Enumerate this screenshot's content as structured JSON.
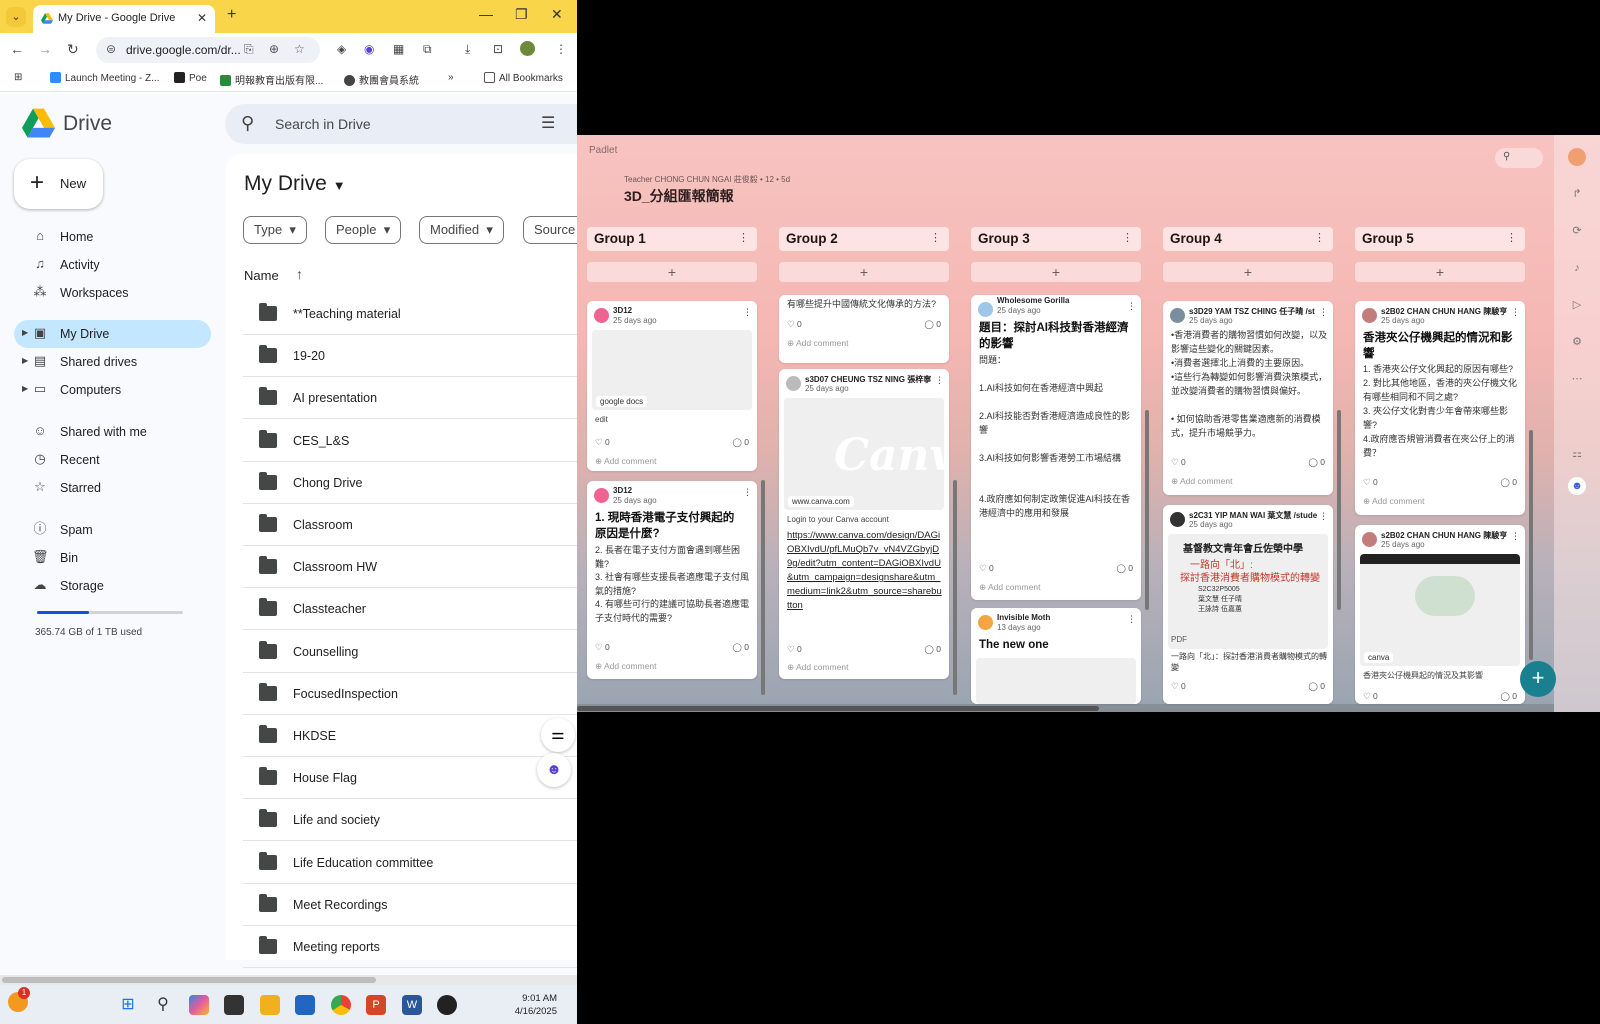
{
  "browser": {
    "tab_title": "My Drive - Google Drive",
    "url": "drive.google.com/dr...",
    "bookmarks": [
      "Launch Meeting - Z...",
      "Poe",
      "明報教育出版有限...",
      "教團會員系統",
      "All Bookmarks"
    ],
    "more_label": "»"
  },
  "drive": {
    "app_name": "Drive",
    "search_placeholder": "Search in Drive",
    "new_label": "New",
    "nav": [
      "Home",
      "Activity",
      "Workspaces",
      "My Drive",
      "Shared drives",
      "Computers",
      "Shared with me",
      "Recent",
      "Starred",
      "Spam",
      "Bin",
      "Storage"
    ],
    "storage_text": "365.74 GB of 1 TB used",
    "storage_fraction": 0.357,
    "page_title": "My Drive",
    "filters": [
      "Type",
      "People",
      "Modified",
      "Source"
    ],
    "column_name": "Name",
    "folders": [
      "**Teaching material",
      "19-20",
      "AI presentation",
      "CES_L&S",
      "Chong Drive",
      "Classroom",
      "Classroom HW",
      "Classteacher",
      "Counselling",
      "FocusedInspection",
      "HKDSE",
      "House Flag",
      "Life and society",
      "Life Education committee",
      "Meet Recordings",
      "Meeting reports"
    ]
  },
  "padlet": {
    "brand": "Padlet",
    "author_line": "Teacher CHONG CHUN NGAI 莊俊毅 • 12 • 5d",
    "title": "3D_分組匯報簡報",
    "add_comment": "Add comment",
    "groups": [
      "Group 1",
      "Group 2",
      "Group 3",
      "Group 4",
      "Group 5"
    ],
    "g1": {
      "c1": {
        "author": "3D12",
        "time": "25 days ago",
        "tag": "google docs",
        "body": "edit",
        "likes": "0",
        "comments": "0"
      },
      "c2": {
        "author": "3D12",
        "time": "25 days ago",
        "title": "1. 現時香港電子支付興起的原因是什麼?",
        "body": [
          "2. 長者在電子支付方面會遇到哪些困難?",
          "3. 社會有哪些支援長者適應電子支付風氣的措施?",
          "4. 有哪些可行的建議可協助長者適應電子支付時代的需要?"
        ],
        "likes": "0",
        "comments": "0"
      }
    },
    "g2": {
      "c1": {
        "body": "有哪些提升中國傳統文化傳承的方法?",
        "likes": "0",
        "comments": "0"
      },
      "c2": {
        "author": "s3D07 CHEUNG TSZ NING 張梓寧",
        "time": "25 days ago",
        "image_text": "Canva",
        "tag": "www.canva.com",
        "sub": "Login to your Canva account",
        "link": "https://www.canva.com/design/DAGiOBXIvdU/pfLMuQb7v_vN4VZGbyjD9g/edit?utm_content=DAGiOBXIvdU&utm_campaign=designshare&utm_medium=link2&utm_source=sharebutton",
        "likes": "0",
        "comments": "0"
      }
    },
    "g3": {
      "c1": {
        "author": "Wholesome Gorilla",
        "time": "25 days ago",
        "title": "題目：探討AI科技對香港經濟的影響",
        "body": [
          "問題：",
          "1.AI科技如何在香港經濟中興起",
          "2.AI科技能否對香港經濟造成良性的影響",
          "3.AI科技如何影響香港勞工市場結構",
          "4.政府應如何制定政策促進AI科技在香港經濟中的應用和發展"
        ],
        "likes": "0",
        "comments": "0"
      },
      "c2": {
        "author": "Invisible Moth",
        "time": "13 days ago",
        "title": "The new one"
      }
    },
    "g4": {
      "c1": {
        "author": "s3D29 YAM TSZ CHING 任子晴 /st",
        "time": "25 days ago",
        "body": [
          "•香港消費者的購物習慣如何改變，以及影響這些變化的關鍵因素。",
          "•消費者選擇北上消費的主要原因。",
          "•這些行為轉變如何影響消費決策模式，並改變消費者的購物習慣與偏好。",
          "• 如何協助香港零售業適應新的消費模式，提升市場競爭力。"
        ],
        "likes": "0",
        "comments": "0"
      },
      "c2": {
        "author": "s2C31 YIP MAN WAI 葉文慧 /stude",
        "time": "25 days ago",
        "poster_school": "基督教文青年會丘佐榮中學",
        "poster_l1": "一路向「北」:",
        "poster_l2": "探討香港消費者購物模式的轉變",
        "poster_names": "S2C32P5005\n葉文慧 任子晴\n王詠詩 伍嘉蕙",
        "tag": "PDF",
        "caption": "一路向「北」：探討香港消費者購物模式的轉變",
        "likes": "0",
        "comments": "0"
      }
    },
    "g5": {
      "c1": {
        "author": "s2B02 CHAN CHUN HANG 陳駿亨",
        "time": "25 days ago",
        "title": "香港夾公仔機興起的情況和影響",
        "body": [
          "1. 香港夾公仔文化興起的原因有哪些?",
          "2. 對比其他地區，香港的夾公仔機文化有哪些相同和不同之處?",
          "3. 夾公仔文化對青少年會帶來哪些影響?",
          "4.政府應否規管消費者在夾公仔上的消費？"
        ],
        "likes": "0",
        "comments": "0"
      },
      "c2": {
        "author": "s2B02 CHAN CHUN HANG 陳駿亨",
        "time": "25 days ago",
        "tag": "canva",
        "caption": "香港夾公仔機興起的情況及其影響",
        "likes": "0",
        "comments": "0"
      }
    }
  },
  "taskbar": {
    "notif_count": "1",
    "time": "9:01 AM",
    "date": "4/16/2025"
  }
}
